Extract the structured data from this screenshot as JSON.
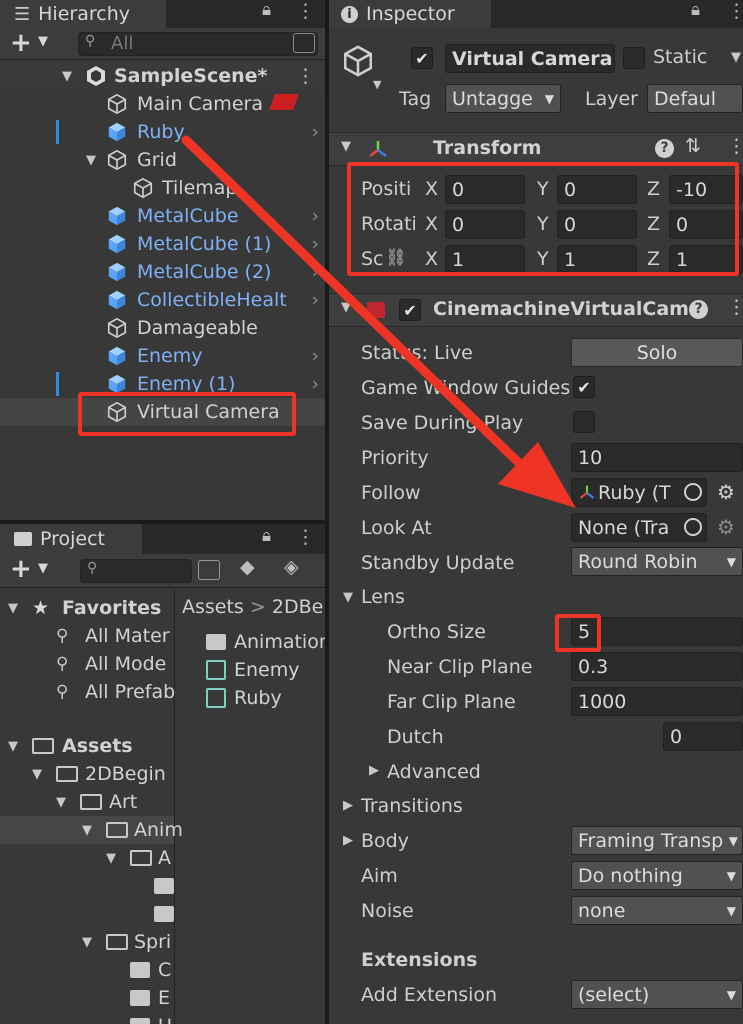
{
  "hierarchy": {
    "tab_label": "Hierarchy",
    "search_placeholder": "All",
    "scene_name": "SampleScene*",
    "items": [
      {
        "label": "Main Camera"
      },
      {
        "label": "Ruby"
      },
      {
        "label": "Grid"
      },
      {
        "label": "Tilemap"
      },
      {
        "label": "MetalCube"
      },
      {
        "label": "MetalCube (1)"
      },
      {
        "label": "MetalCube (2)"
      },
      {
        "label": "CollectibleHealt"
      },
      {
        "label": "Damageable"
      },
      {
        "label": "Enemy"
      },
      {
        "label": "Enemy (1)"
      },
      {
        "label": "Virtual Camera"
      }
    ]
  },
  "project": {
    "tab_label": "Project",
    "favorites_label": "Favorites",
    "favorites": [
      "All Mater",
      "All Mode",
      "All Prefab"
    ],
    "assets_label": "Assets",
    "tree": [
      "2DBegin",
      "Art",
      "Anim",
      "A",
      "Spri",
      "C",
      "E",
      "U"
    ],
    "breadcrumb": [
      "Assets",
      "2DBe"
    ],
    "files": [
      "Animation",
      "Enemy",
      "Ruby"
    ]
  },
  "inspector": {
    "tab_label": "Inspector",
    "object_name": "Virtual Camera",
    "static_label": "Static",
    "tag_label": "Tag",
    "tag_value": "Untagge",
    "layer_label": "Layer",
    "layer_value": "Defaul",
    "transform": {
      "title": "Transform",
      "rows": [
        {
          "label": "Positi",
          "x": "0",
          "y": "0",
          "z": "-10"
        },
        {
          "label": "Rotati",
          "x": "0",
          "y": "0",
          "z": "0"
        },
        {
          "label": "Sc",
          "x": "1",
          "y": "1",
          "z": "1"
        }
      ],
      "axis_x": "X",
      "axis_y": "Y",
      "axis_z": "Z"
    },
    "vcam": {
      "title": "CinemachineVirtualCam",
      "status_label": "Status: Live",
      "solo_label": "Solo",
      "guides_label": "Game Window Guides",
      "save_play_label": "Save During Play",
      "priority_label": "Priority",
      "priority_value": "10",
      "follow_label": "Follow",
      "follow_value": "Ruby (T",
      "lookat_label": "Look At",
      "lookat_value": "None (Tra",
      "standby_label": "Standby Update",
      "standby_value": "Round Robin",
      "lens_label": "Lens",
      "ortho_label": "Ortho Size",
      "ortho_value": "5",
      "near_label": "Near Clip Plane",
      "near_value": "0.3",
      "far_label": "Far Clip Plane",
      "far_value": "1000",
      "dutch_label": "Dutch",
      "dutch_value": "0",
      "advanced_label": "Advanced",
      "transitions_label": "Transitions",
      "body_label": "Body",
      "body_value": "Framing Transp",
      "aim_label": "Aim",
      "aim_value": "Do nothing",
      "noise_label": "Noise",
      "noise_value": "none",
      "extensions_label": "Extensions",
      "add_extension_label": "Add Extension",
      "add_extension_value": "(select)"
    }
  },
  "colors": {
    "highlight": "#ee3424",
    "prefab_blue": "#7fb1f4",
    "panel_bg": "#383838"
  }
}
